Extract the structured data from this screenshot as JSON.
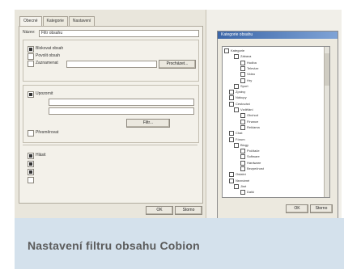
{
  "caption": "Nastavení filtru obsahu Cobion",
  "left_dialog": {
    "tabs": [
      "Obecné",
      "Kategorie",
      "Nastavení"
    ],
    "name_label": "Název:",
    "name_value": "Filtr obsahu",
    "buttons": {
      "browse": "Procházet...",
      "filter": "Filtr...",
      "ok": "OK",
      "cancel": "Storno"
    },
    "options": [
      "Blokovat obsah",
      "Povolit obsah",
      "Zaznamenat",
      "Upozornit",
      "Přesměrovat",
      "Hlásit"
    ]
  },
  "right_dialog": {
    "title": "Kategorie obsahu",
    "ok": "OK",
    "cancel": "Storno",
    "tree": [
      "Kategorie",
      "Zábava",
      "Hudba",
      "Televize",
      "Video",
      "Hry",
      "Sport",
      "Zprávy",
      "Nákupy",
      "Cestování",
      "Vzdělání",
      "Obchod",
      "Finance",
      "Reklama",
      "Chat",
      "Fórum",
      "Blogy",
      "Počítače",
      "Software",
      "Hardware",
      "Bezpečnost",
      "Ostatní",
      "Neznámé",
      "Jiné",
      "Další"
    ]
  }
}
